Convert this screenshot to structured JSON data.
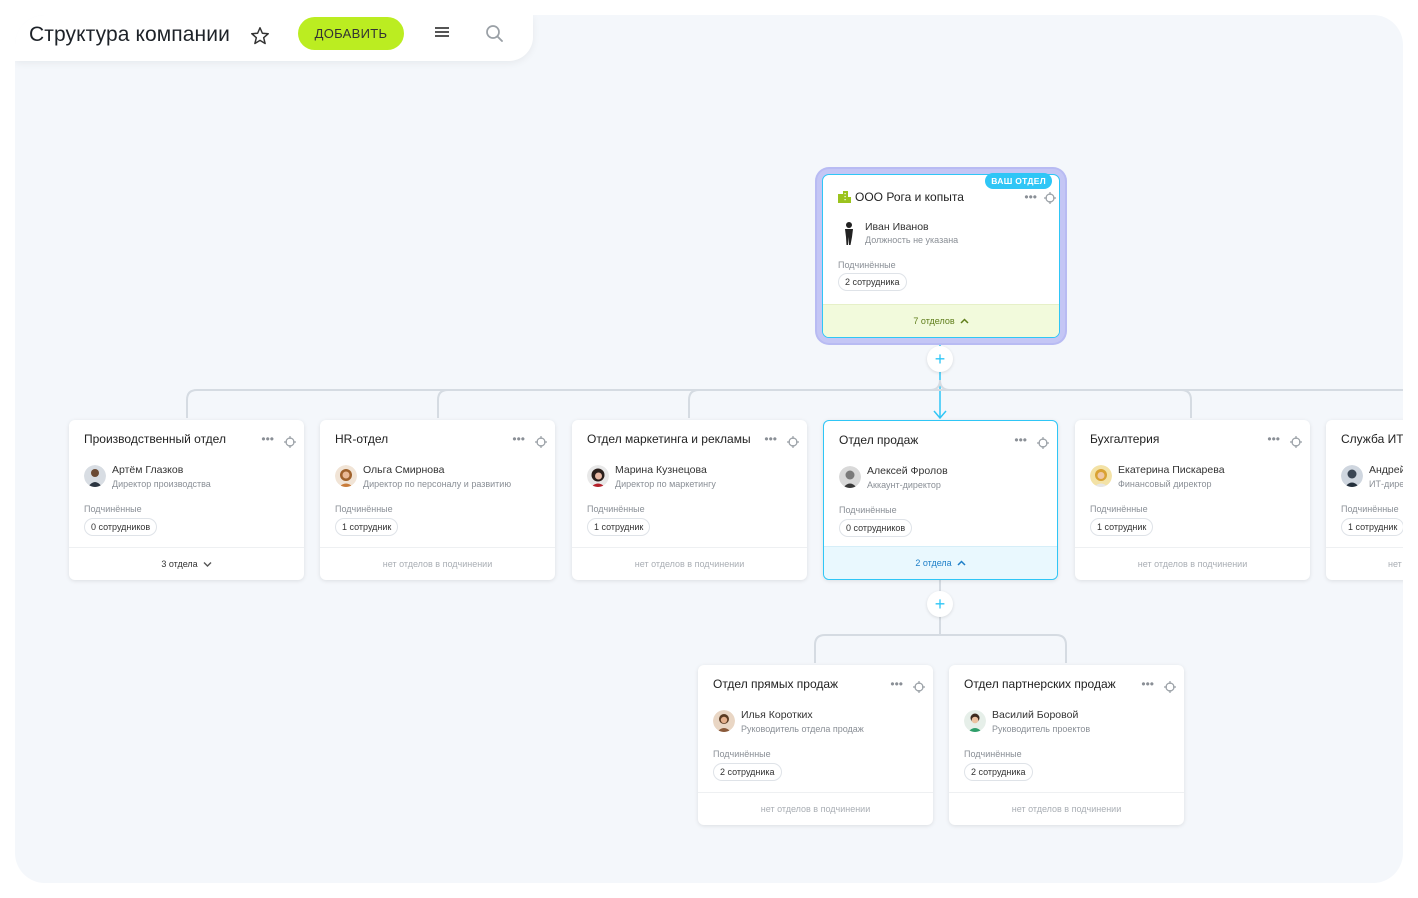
{
  "toolbar": {
    "title": "Структура компании",
    "add_label": "ДОБАВИТЬ"
  },
  "icons": [
    "star-icon",
    "menu-icon",
    "search-icon",
    "more-icon",
    "target-icon",
    "building-icon",
    "plus-icon",
    "chevron-up-icon",
    "chevron-down-icon"
  ],
  "colors": {
    "accent": "#2fc6f6",
    "add_button": "#bbed21",
    "root_halo": "#c4c6f5",
    "root_footer": "#f2fadc"
  },
  "root": {
    "badge": "ВАШ ОТДЕЛ",
    "name": "ООО Рога и копыта",
    "head_name": "Иван Иванов",
    "head_role": "Должность не указана",
    "subordinates_label": "Подчинённые",
    "subordinates_count": "2 сотрудника",
    "footer": "7 отделов"
  },
  "departments": [
    {
      "name": "Производственный отдел",
      "head_name": "Артём Глазков",
      "head_role": "Директор производства",
      "subordinates_label": "Подчинённые",
      "subordinates_count": "0 сотрудников",
      "footer": "3 отдела"
    },
    {
      "name": "HR-отдел",
      "head_name": "Ольга Смирнова",
      "head_role": "Директор по персоналу и развитию",
      "subordinates_label": "Подчинённые",
      "subordinates_count": "1 сотрудник",
      "footer": "нет отделов в подчинении"
    },
    {
      "name": "Отдел маркетинга и рекламы",
      "head_name": "Марина Кузнецова",
      "head_role": "Директор по маркетингу",
      "subordinates_label": "Подчинённые",
      "subordinates_count": "1 сотрудник",
      "footer": "нет отделов в подчинении"
    },
    {
      "name": "Отдел продаж",
      "head_name": "Алексей Фролов",
      "head_role": "Аккаунт-директор",
      "subordinates_label": "Подчинённые",
      "subordinates_count": "0 сотрудников",
      "footer": "2 отдела"
    },
    {
      "name": "Бухгалтерия",
      "head_name": "Екатерина Пискарева",
      "head_role": "Финансовый директор",
      "subordinates_label": "Подчинённые",
      "subordinates_count": "1 сотрудник",
      "footer": "нет отделов в подчинении"
    },
    {
      "name": "Служба ИТ",
      "head_name": "Андрей",
      "head_role": "ИТ-дире",
      "subordinates_label": "Подчинённые",
      "subordinates_count": "1 сотрудник",
      "footer": "нет"
    }
  ],
  "sub_departments": [
    {
      "name": "Отдел прямых продаж",
      "head_name": "Илья Коротких",
      "head_role": "Руководитель отдела продаж",
      "subordinates_label": "Подчинённые",
      "subordinates_count": "2 сотрудника",
      "footer": "нет отделов в подчинении"
    },
    {
      "name": "Отдел партнерских продаж",
      "head_name": "Василий Боровой",
      "head_role": "Руководитель проектов",
      "subordinates_label": "Подчинённые",
      "subordinates_count": "2 сотрудника",
      "footer": "нет отделов в подчинении"
    }
  ]
}
